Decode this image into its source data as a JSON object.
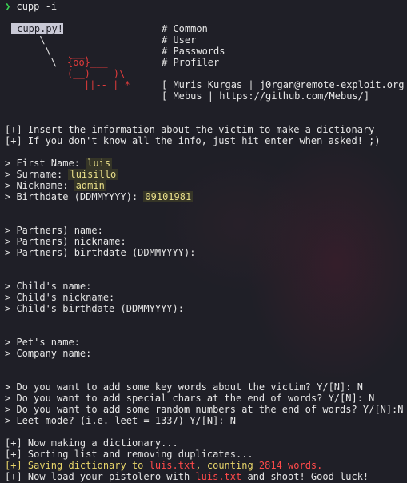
{
  "prompt": {
    "symbol": "❯",
    "command": "cupp -i"
  },
  "banner": {
    "label": "cupp.py!",
    "art_l1": "      \\",
    "art_l2": "       \\",
    "art_l3": "        \\",
    "art_roof": ".___.",
    "art_face": "{oo}___",
    "art_body": "(__)    )\\",
    "art_legs": "||--|| *",
    "menu": [
      "# Common",
      "# User",
      "# Passwords",
      "# Profiler"
    ],
    "credit1": "[ Muris Kurgas | j0rgan@remote-exploit.org ]",
    "credit2": "[ Mebus | https://github.com/Mebus/]"
  },
  "intro": [
    "[+] Insert the information about the victim to make a dictionary",
    "[+] If you don't know all the info, just hit enter when asked! ;)"
  ],
  "fields": [
    {
      "label": "> First Name: ",
      "value": "luis"
    },
    {
      "label": "> Surname: ",
      "value": "luisillo"
    },
    {
      "label": "> Nickname: ",
      "value": "admin"
    },
    {
      "label": "> Birthdate (DDMMYYYY): ",
      "value": "09101981"
    }
  ],
  "partners": [
    "> Partners) name:",
    "> Partners) nickname:",
    "> Partners) birthdate (DDMMYYYY):"
  ],
  "child": [
    "> Child's name:",
    "> Child's nickname:",
    "> Child's birthdate (DDMMYYYY):"
  ],
  "pet": [
    "> Pet's name:",
    "> Company name:"
  ],
  "questions": [
    "> Do you want to add some key words about the victim? Y/[N]: N",
    "> Do you want to add special chars at the end of words? Y/[N]: N",
    "> Do you want to add some random numbers at the end of words? Y/[N]:N",
    "> Leet mode? (i.e. leet = 1337) Y/[N]: N"
  ],
  "status": {
    "l1": "[+] Now making a dictionary...",
    "l2": "[+] Sorting list and removing duplicates...",
    "l3_prefix": "[+] Saving dictionary to ",
    "l3_file": "luis.txt",
    "l3_mid": ", counting ",
    "l3_count": "2814 words.",
    "l4_prefix": "[+] Now load your pistolero with ",
    "l4_file": "luis.txt",
    "l4_suffix": " and shoot! Good luck!"
  }
}
